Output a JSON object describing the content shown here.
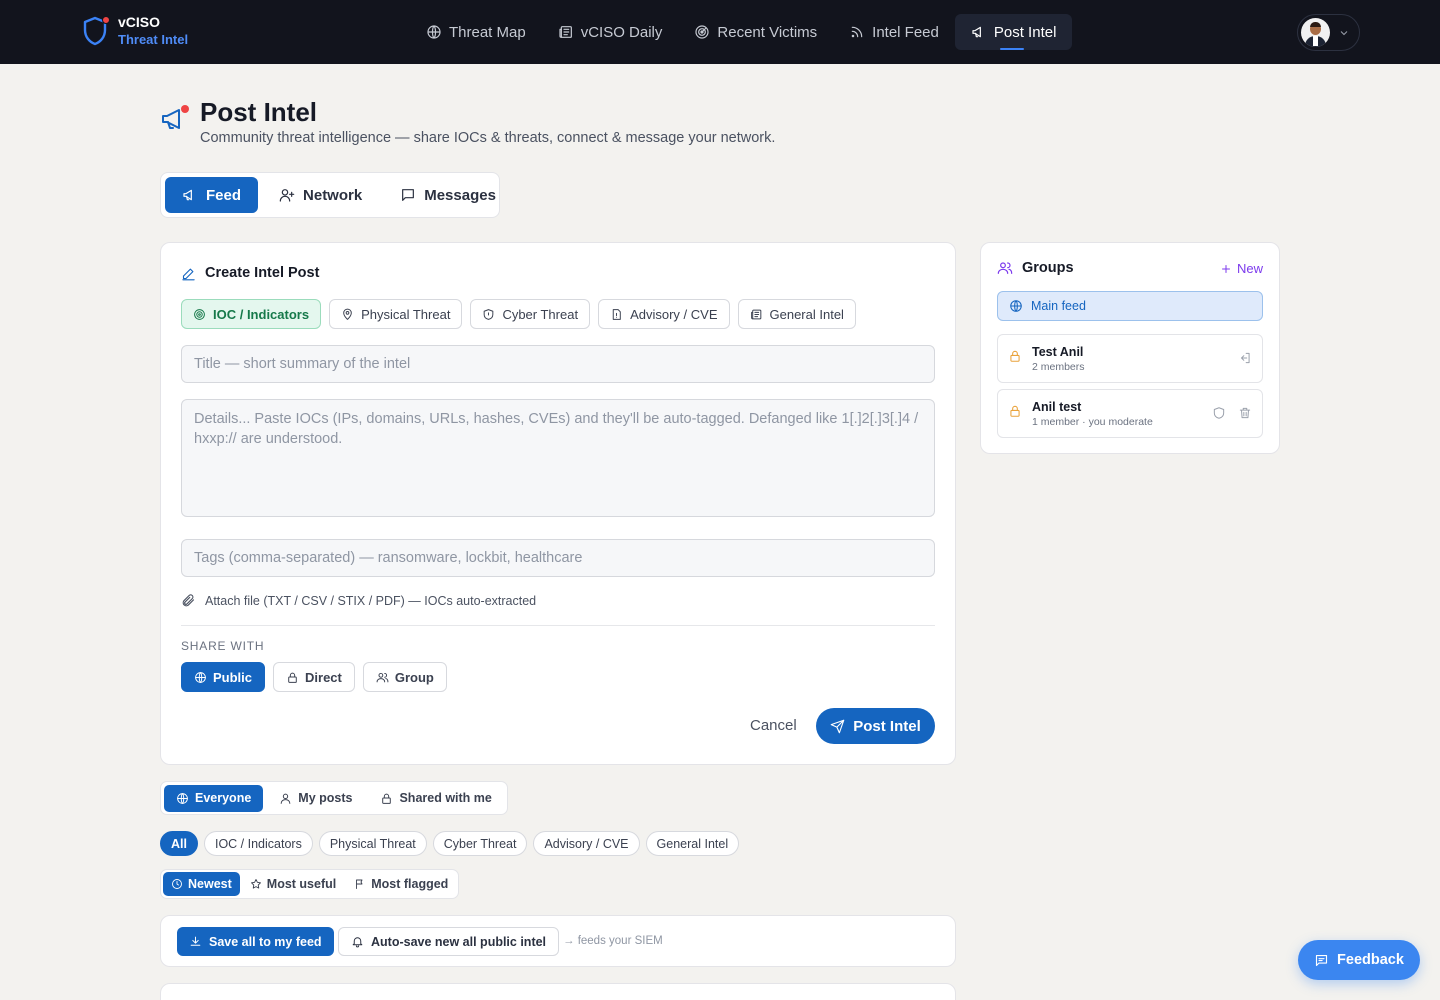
{
  "brand": {
    "name": "vCISO",
    "subtitle": "Threat Intel"
  },
  "nav": [
    {
      "label": "Threat Map",
      "icon": "globe-icon"
    },
    {
      "label": "vCISO Daily",
      "icon": "newspaper-icon"
    },
    {
      "label": "Recent Victims",
      "icon": "radar-icon"
    },
    {
      "label": "Intel Feed",
      "icon": "rss-icon"
    },
    {
      "label": "Post Intel",
      "icon": "megaphone-icon",
      "active": true
    }
  ],
  "page": {
    "title": "Post Intel",
    "subtitle": "Community threat intelligence — share IOCs & threats, connect & message your network."
  },
  "tabs": {
    "feed": "Feed",
    "network": "Network",
    "messages": "Messages",
    "active": "Feed"
  },
  "create": {
    "title": "Create Intel Post",
    "types": [
      "IOC / Indicators",
      "Physical Threat",
      "Cyber Threat",
      "Advisory / CVE",
      "General Intel"
    ],
    "active_type": "IOC / Indicators",
    "title_placeholder": "Title — short summary of the intel",
    "details_placeholder": "Details... Paste IOCs (IPs, domains, URLs, hashes, CVEs) and they'll be auto-tagged. Defanged like 1[.]2[.]3[.]4 / hxxp:// are understood.",
    "tags_placeholder": "Tags (comma-separated) — ransomware, lockbit, healthcare",
    "attach_label": "Attach file (TXT / CSV / STIX / PDF) — IOCs auto-extracted",
    "share_label": "SHARE WITH",
    "share_options": [
      "Public",
      "Direct",
      "Group"
    ],
    "share_active": "Public",
    "cancel_label": "Cancel",
    "submit_label": "Post Intel"
  },
  "groups": {
    "title": "Groups",
    "new_label": "New",
    "main_feed": "Main feed",
    "items": [
      {
        "name": "Test Anil",
        "meta": "2 members"
      },
      {
        "name": "Anil test",
        "meta": "1 member · you moderate"
      }
    ]
  },
  "scope": {
    "everyone": "Everyone",
    "my_posts": "My posts",
    "shared": "Shared with me",
    "active": "Everyone"
  },
  "categories": [
    "All",
    "IOC / Indicators",
    "Physical Threat",
    "Cyber Threat",
    "Advisory / CVE",
    "General Intel"
  ],
  "active_category": "All",
  "sort": {
    "newest": "Newest",
    "useful": "Most useful",
    "flagged": "Most flagged",
    "active": "Newest"
  },
  "feed_actions": {
    "save_all": "Save all to my feed",
    "autosave": "Auto-save new all public intel",
    "note": "→ feeds your SIEM"
  },
  "feedback_label": "Feedback",
  "colors": {
    "nav_bg": "#12141d",
    "accent": "#1565c0",
    "ioc_green": "#16794a",
    "groups_purple": "#7c3aed",
    "alert_red": "#ef4444",
    "feedback_blue": "#3b86f0"
  }
}
